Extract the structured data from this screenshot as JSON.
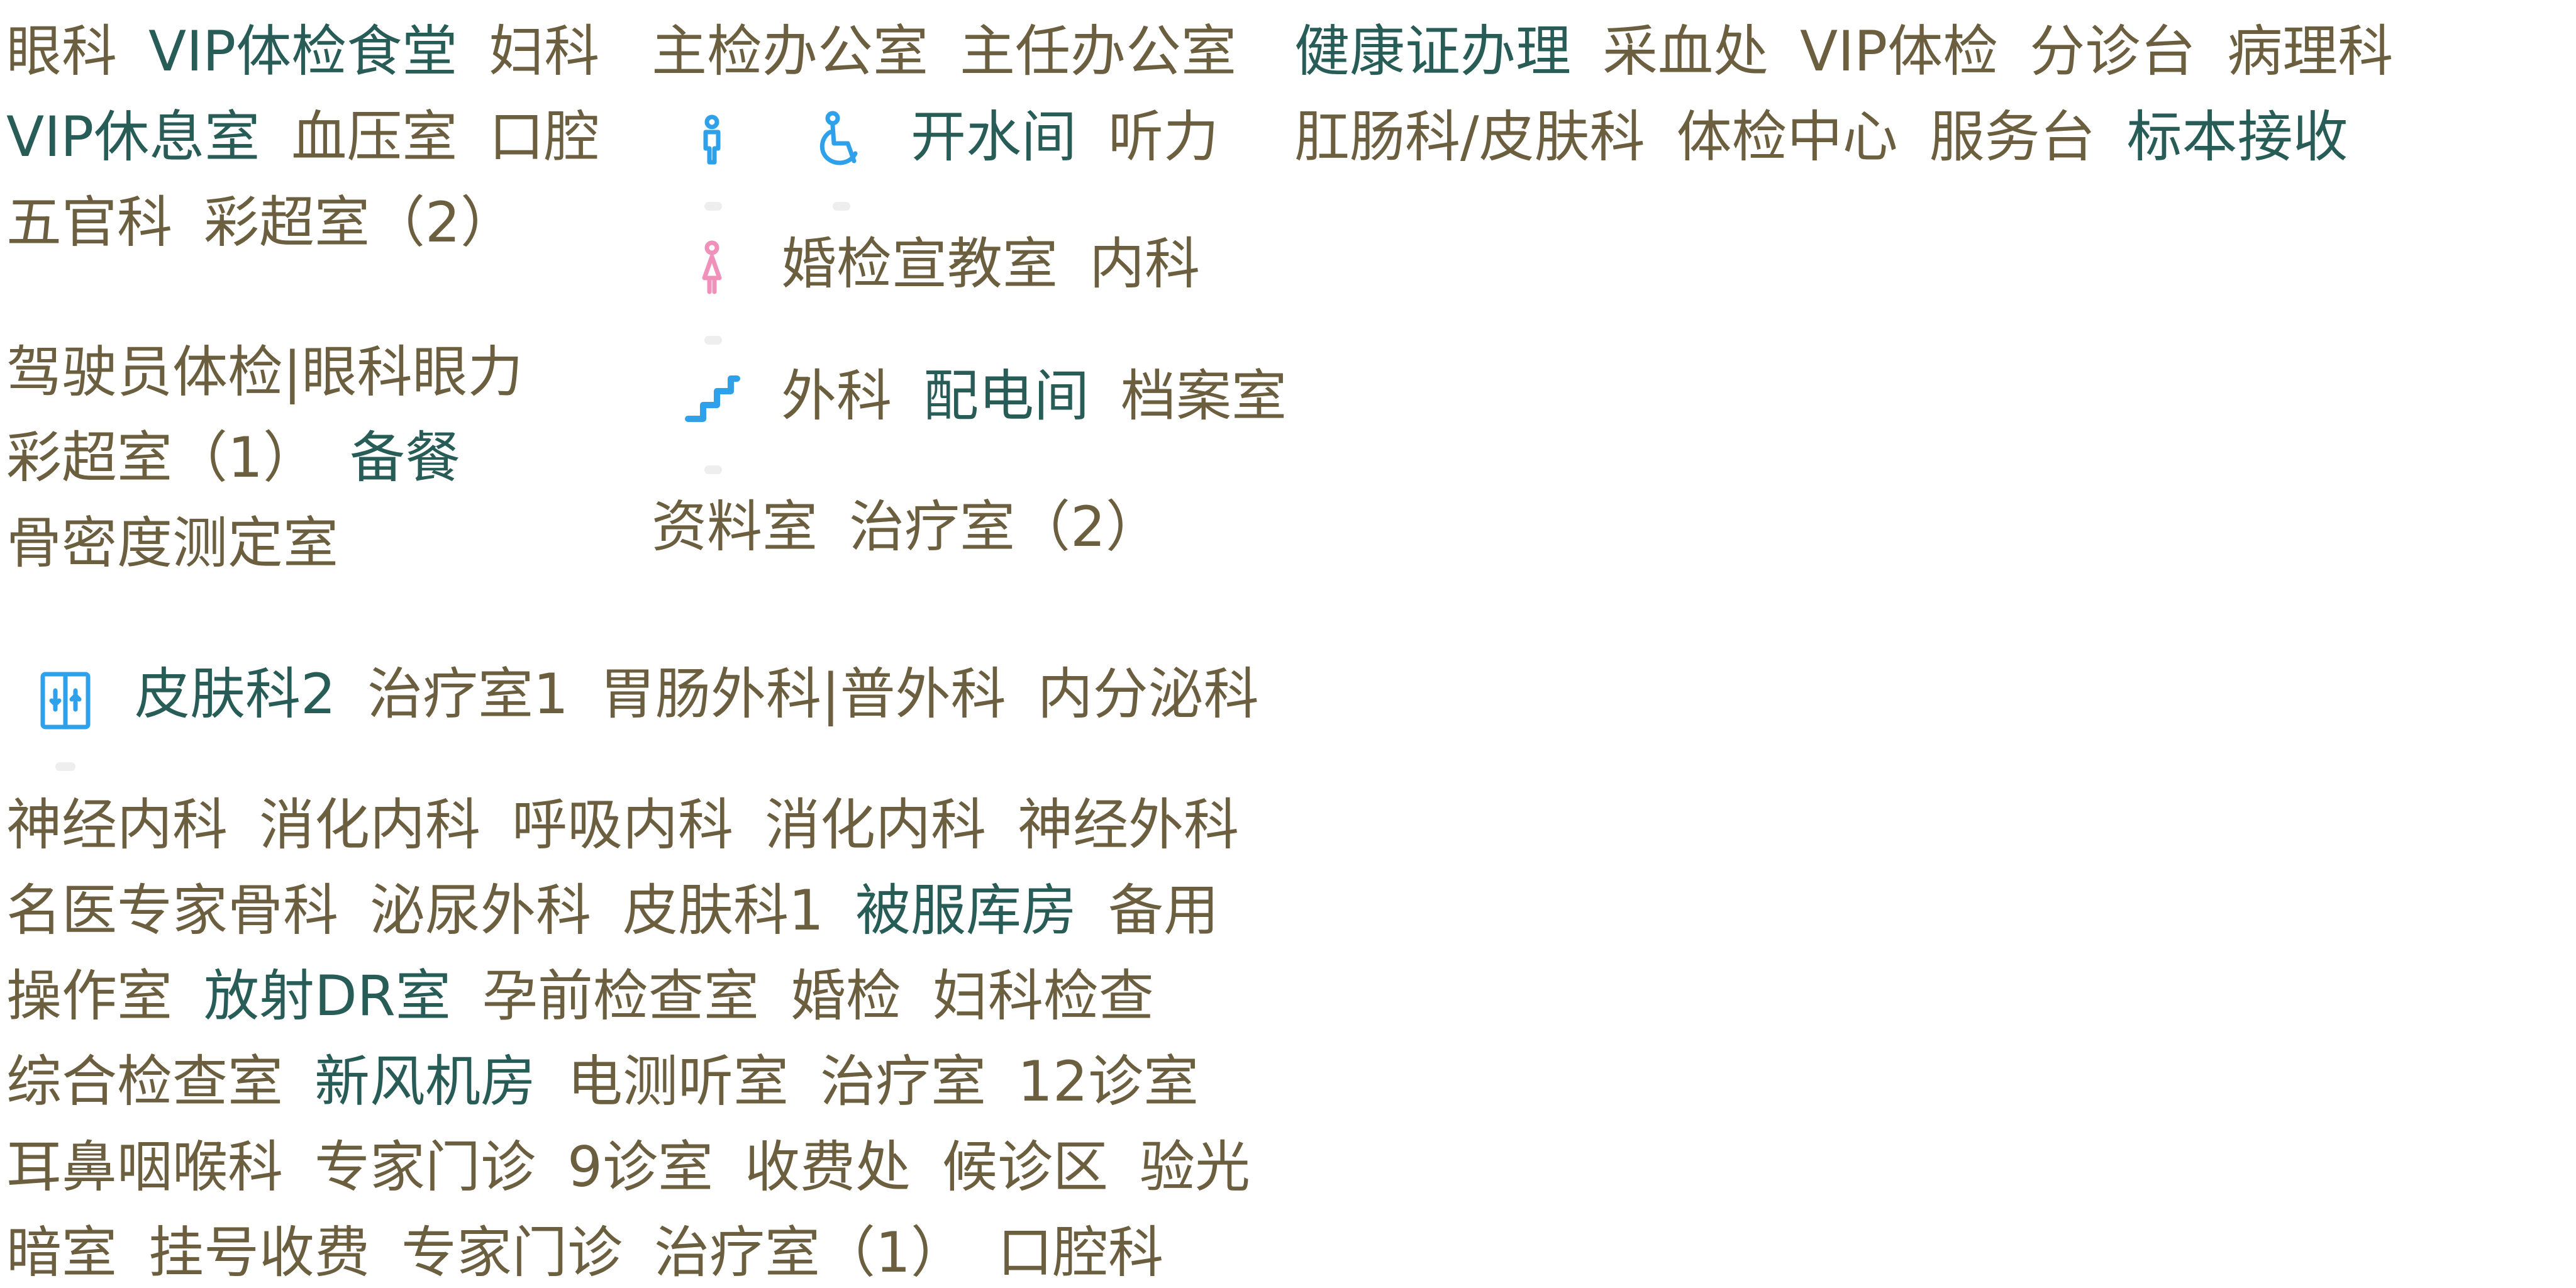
{
  "colors": {
    "olive": "#6b5f3f",
    "teal": "#285c57",
    "accent_blue": "#2fa1ea",
    "accent_pink": "#f091bb",
    "dot": "#eeeeee"
  },
  "icons": {
    "male_toilet": "male-restroom-icon",
    "accessible": "accessible-icon",
    "female_toilet": "female-restroom-icon",
    "stairs": "stairs-icon",
    "elevator": "elevator-icon"
  },
  "labels": {
    "top_left": [
      "眼科",
      "VIP体检食堂",
      "妇科"
    ],
    "top_mid": [
      "主检办公室",
      "主任办公室"
    ],
    "top_right": [
      "健康证办理",
      "采血处",
      "VIP体检",
      "分诊台",
      "病理科"
    ],
    "second_left": [
      "VIP休息室",
      "血压室",
      "口腔"
    ],
    "second_mid": [
      "开水间",
      "听力"
    ],
    "second_right": [
      "肛肠科/皮肤科",
      "体检中心",
      "服务台",
      "标本接收"
    ],
    "third_left": [
      "五官科",
      "彩超室（2）"
    ],
    "fourth_mid": [
      "婚检宣教室",
      "内科"
    ],
    "fifth_left": [
      "驾驶员体检|眼科眼力"
    ],
    "fifth_mid": [
      "外科",
      "配电间",
      "档案室"
    ],
    "sixth_left": [
      "彩超室（1）",
      "备餐"
    ],
    "seventh_left": [
      "骨密度测定室"
    ],
    "eighth_mid": [
      "资料室",
      "治疗室（2）"
    ],
    "ninth": [
      "皮肤科2",
      "治疗室1",
      "胃肠外科|普外科",
      "内分泌科"
    ],
    "row1": [
      "神经内科",
      "消化内科",
      "呼吸内科",
      "消化内科",
      "神经外科"
    ],
    "row2": [
      "名医专家骨科",
      "泌尿外科",
      "皮肤科1",
      "被服库房",
      "备用"
    ],
    "row3": [
      "操作室",
      "放射DR室",
      "孕前检查室",
      "婚检",
      "妇科检查"
    ],
    "row4": [
      "综合检查室",
      "新风机房",
      "电测听室",
      "治疗室",
      "12诊室"
    ],
    "row5": [
      "耳鼻咽喉科",
      "专家门诊",
      "9诊室",
      "收费处",
      "候诊区",
      "验光"
    ],
    "row6": [
      "暗室",
      "挂号收费",
      "专家门诊",
      "治疗室（1）",
      "口腔科"
    ]
  }
}
